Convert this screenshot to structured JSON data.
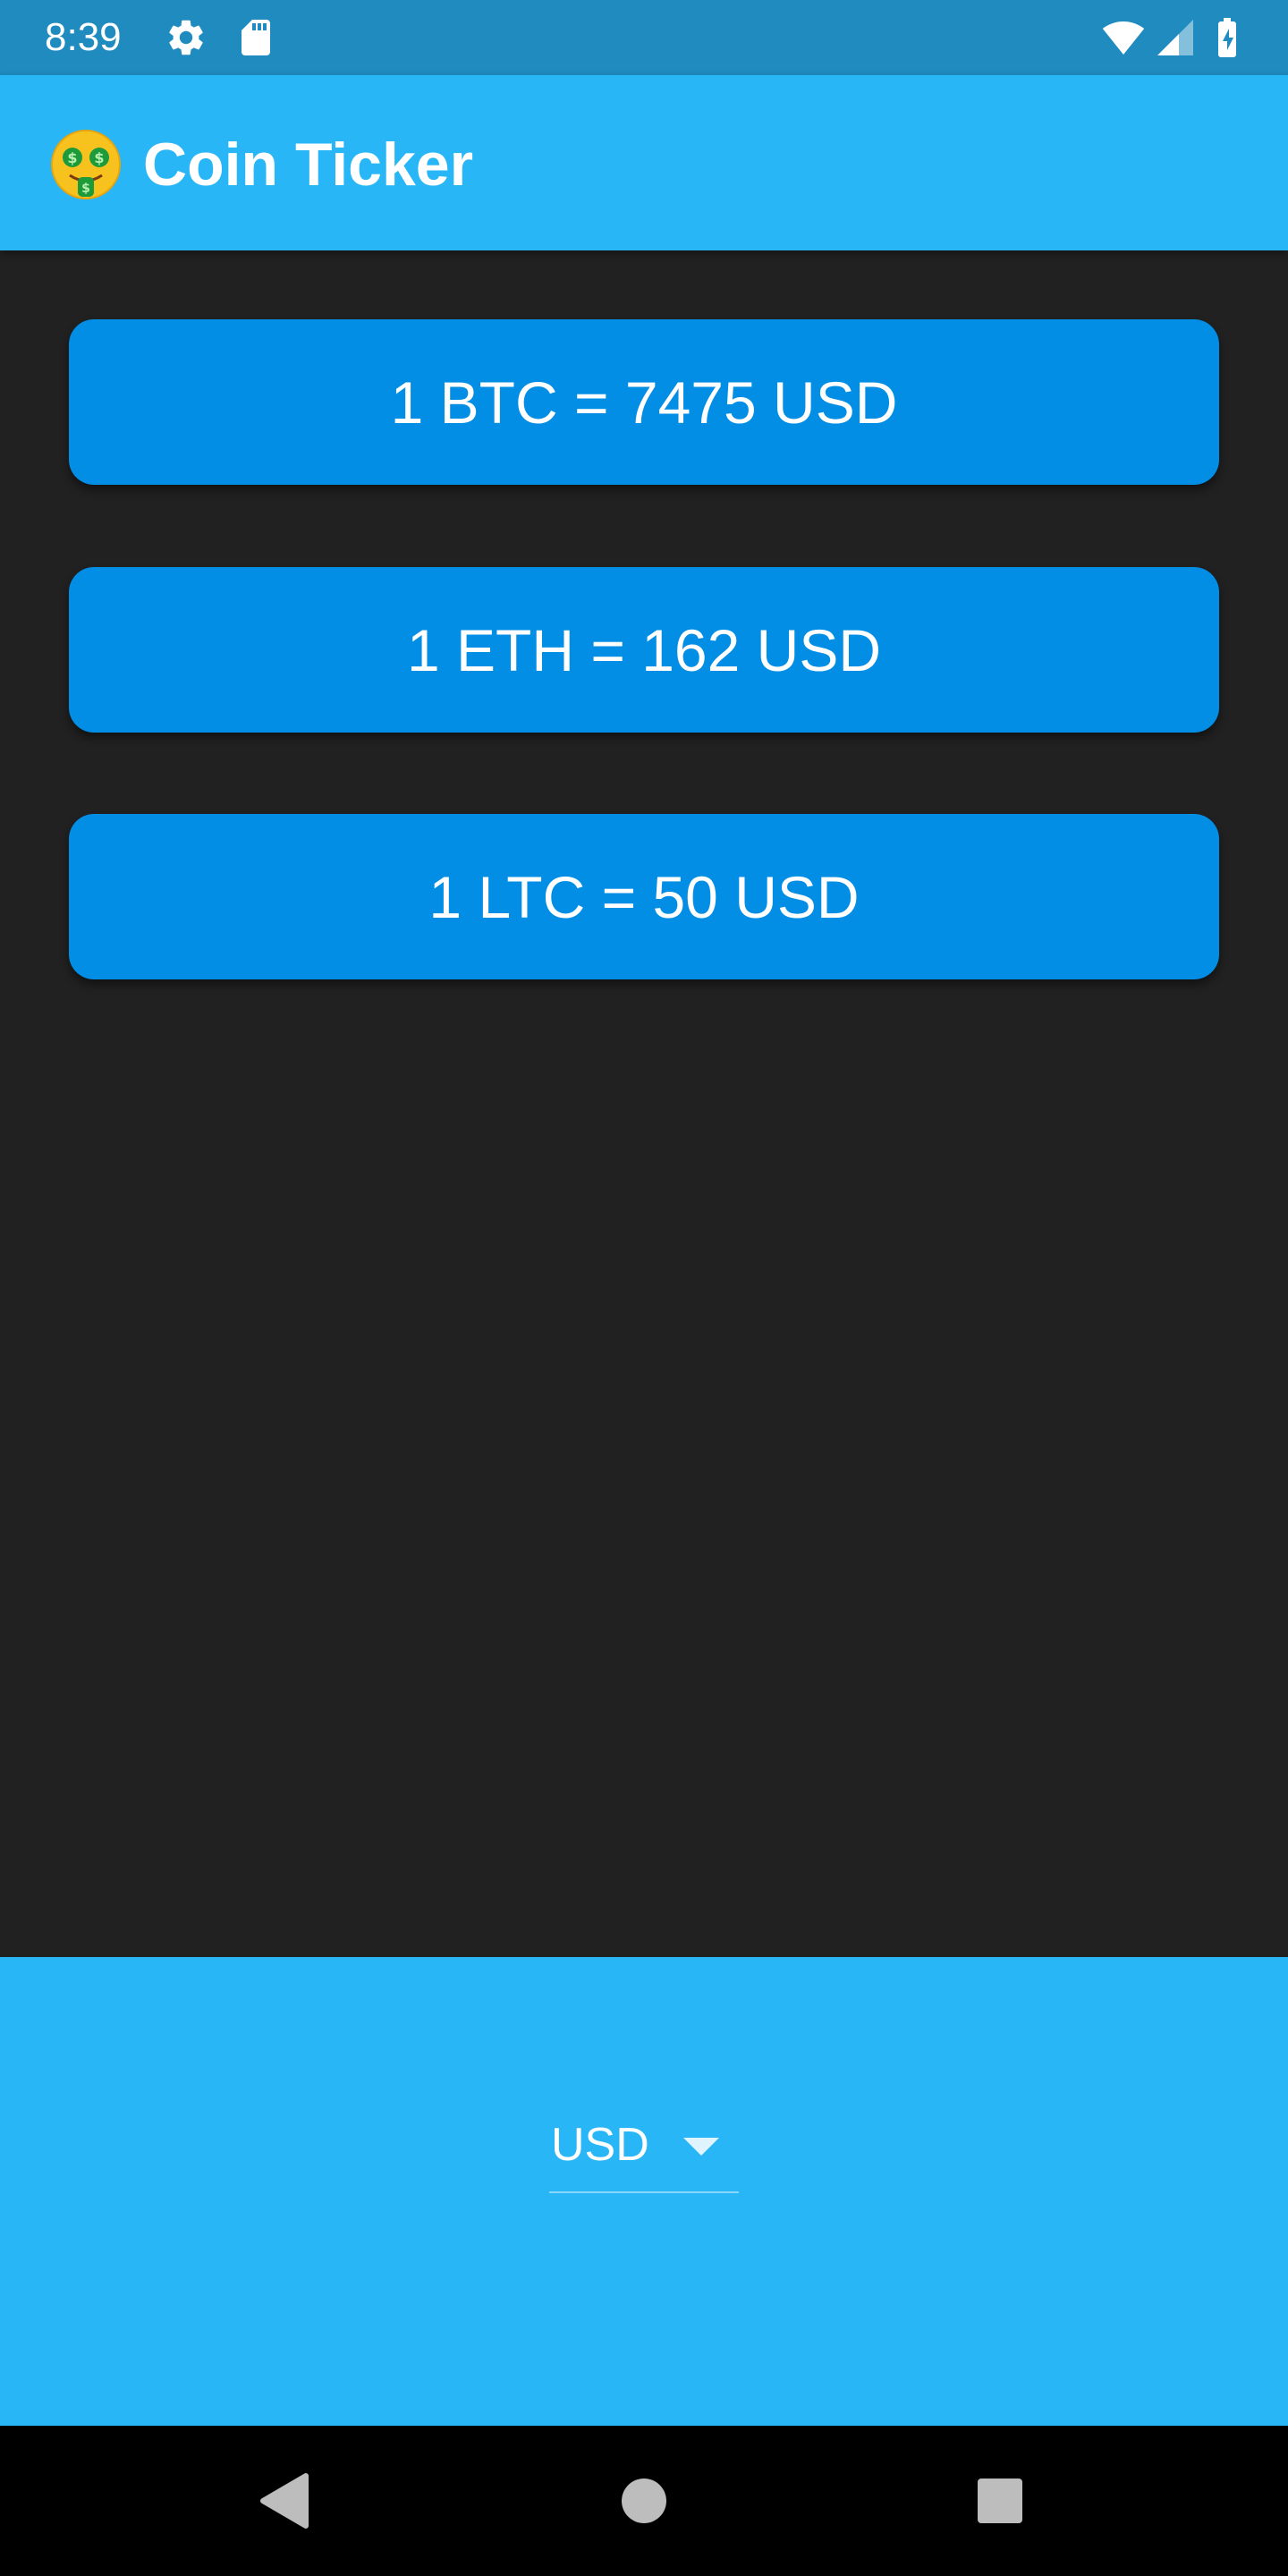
{
  "status_bar": {
    "time": "8:39",
    "icons": [
      "settings-icon",
      "sd-card-icon",
      "wifi-icon",
      "cell-signal-icon",
      "battery-charging-icon"
    ]
  },
  "app_bar": {
    "emoji_icon": "money-mouth-face-icon",
    "title": "Coin Ticker"
  },
  "rates": [
    {
      "label": "1 BTC = 7475 USD"
    },
    {
      "label": "1 ETH = 162 USD"
    },
    {
      "label": "1 LTC = 50 USD"
    }
  ],
  "currency_picker": {
    "selected": "USD",
    "icon": "dropdown-arrow-icon"
  },
  "nav_bar": {
    "buttons": [
      "back-icon",
      "home-icon",
      "recents-icon"
    ]
  },
  "colors": {
    "status_bar": "#1f8bbf",
    "app_bar": "#29b6f6",
    "background": "#212121",
    "card": "#038ee6",
    "picker_panel": "#29b6f6",
    "nav_bar": "#000000"
  }
}
